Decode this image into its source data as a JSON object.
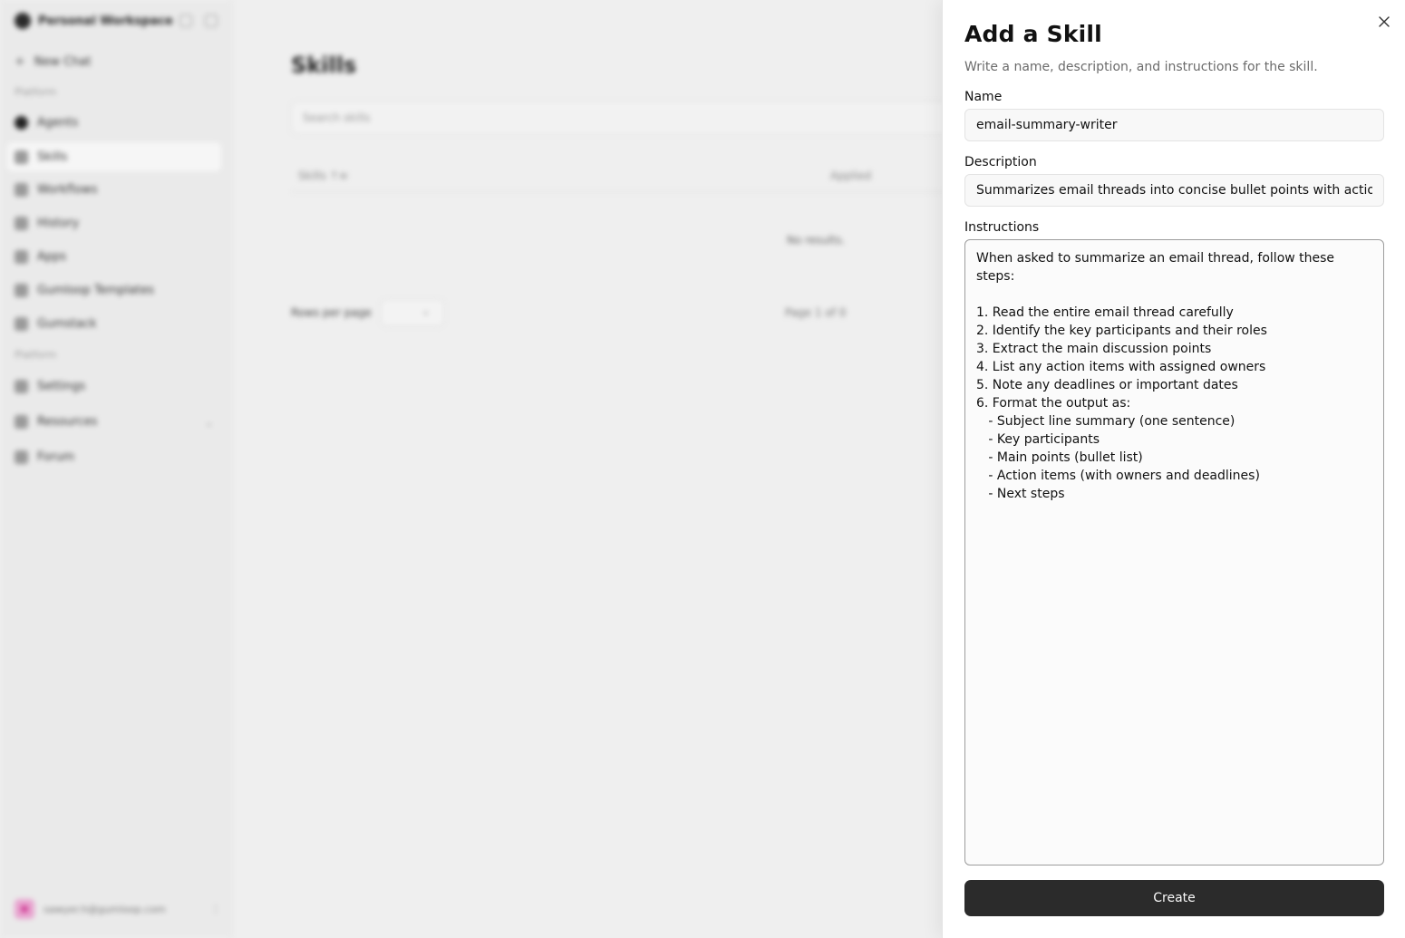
{
  "background": {
    "workspace_name": "Personal Workspace",
    "new_chat": "New Chat",
    "section_1": "Platform",
    "nav": [
      "Agents",
      "Skills",
      "Workflows",
      "History",
      "Apps",
      "Gumloop Templates",
      "Gumstack"
    ],
    "section_2": "Platform",
    "nav2": [
      "Settings",
      "Resources",
      "Forum"
    ],
    "user_email": "sawyer.h@gumloop.com",
    "page_title": "Skills",
    "search_placeholder": "Search skills",
    "col_skills": "Skills ↑≡",
    "col_applied": "Applied",
    "no_results": "No results.",
    "rows_per_page": "Rows per page",
    "page_info": "Page 1 of 0"
  },
  "drawer": {
    "title": "Add a Skill",
    "subtitle": "Write a name, description, and instructions for the skill.",
    "name_label": "Name",
    "name_value": "email-summary-writer",
    "description_label": "Description",
    "description_value": "Summarizes email threads into concise bullet points with action items",
    "instructions_label": "Instructions",
    "instructions_value": "When asked to summarize an email thread, follow these steps:\n\n1. Read the entire email thread carefully\n2. Identify the key participants and their roles\n3. Extract the main discussion points\n4. List any action items with assigned owners\n5. Note any deadlines or important dates\n6. Format the output as:\n   - Subject line summary (one sentence)\n   - Key participants\n   - Main points (bullet list)\n   - Action items (with owners and deadlines)\n   - Next steps",
    "create_label": "Create",
    "close_icon": "close-icon"
  }
}
